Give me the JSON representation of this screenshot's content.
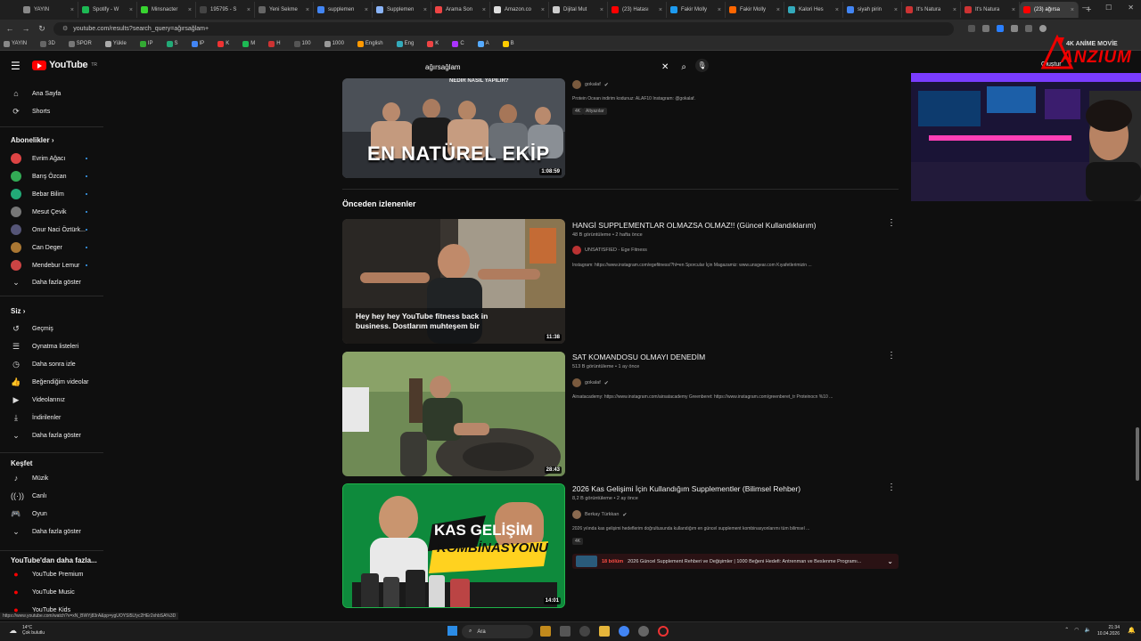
{
  "browser": {
    "tabs": [
      {
        "label": "YAYIN",
        "color": "#888"
      },
      {
        "label": "Spotify - W",
        "color": "#1db954"
      },
      {
        "label": "Minsnacter",
        "color": "#38d430"
      },
      {
        "label": "195795 - S",
        "color": "#444"
      },
      {
        "label": "Yeni Sekme",
        "color": "#666"
      },
      {
        "label": "supplemen",
        "color": "#4285f4"
      },
      {
        "label": "Supplemen",
        "color": "#8ab4f8"
      },
      {
        "label": "Arama Son",
        "color": "#e44"
      },
      {
        "label": "Amazon.co",
        "color": "#ddd"
      },
      {
        "label": "Dijital Mut",
        "color": "#ccc"
      },
      {
        "label": "(23) Hatası",
        "color": "#f00"
      },
      {
        "label": "Fakir Molly",
        "color": "#1d9bf0"
      },
      {
        "label": "Fakir Molly",
        "color": "#f60"
      },
      {
        "label": "Kalori Hes",
        "color": "#3ab"
      },
      {
        "label": "siyah pirin",
        "color": "#4285f4"
      },
      {
        "label": "It's Natura",
        "color": "#c33"
      },
      {
        "label": "It's Natura",
        "color": "#c33"
      },
      {
        "label": "(23) ağırsa",
        "color": "#f00"
      }
    ],
    "url": "youtube.com/results?search_query=ağırsağlam+",
    "bookmarks": [
      "YAYIN",
      "3D",
      "SPOR",
      "Yükle",
      "IP",
      "S",
      "IP",
      "K",
      "M",
      "H",
      "100",
      "1000",
      "English",
      "Eng",
      "K",
      "C",
      "A",
      "B"
    ]
  },
  "header": {
    "logo_text": "YouTube",
    "logo_sup": "TR",
    "search_query": "ağırsağlam",
    "create_label": "Oluştur"
  },
  "sidebar": {
    "home": "Ana Sayfa",
    "shorts": "Shorts",
    "subs_title": "Abonelikler",
    "channels": [
      {
        "name": "Evrim Ağacı",
        "color": "#d44"
      },
      {
        "name": "Barış Özcan",
        "color": "#3a5"
      },
      {
        "name": "Bebar Bilim",
        "color": "#2a7"
      },
      {
        "name": "Mesut Çevik",
        "color": "#777"
      },
      {
        "name": "Onur Naci Öztürk...",
        "color": "#557"
      },
      {
        "name": "Can Deger",
        "color": "#a73"
      },
      {
        "name": "Mendebur Lemur",
        "color": "#c44"
      }
    ],
    "subs_more": "Daha fazla göster",
    "you_title": "Siz",
    "you_items": [
      "Geçmiş",
      "Oynatma listeleri",
      "Daha sonra izle",
      "Beğendiğim videolar",
      "Videolarınız",
      "İndirilenler",
      "Daha fazla göster"
    ],
    "explore_title": "Keşfet",
    "explore_items": [
      "Müzik",
      "Canlı",
      "Oyun",
      "Daha fazla göster"
    ],
    "more_title": "YouTube'dan daha fazla...",
    "more_items": [
      "YouTube Premium",
      "YouTube Music",
      "YouTube Kids"
    ]
  },
  "results": {
    "first": {
      "thumb_text": "EN NATÜREL EKİP",
      "thumb_top": "NEDİR NASIL YAPILIR?",
      "duration": "1:08:59",
      "channel": "gokalaf",
      "desc": "Protein Ocean indirim kodunuz: ALAF10 Instagram: @gokalaf.",
      "badges": [
        "4K",
        "Altyazılar"
      ]
    },
    "section_title": "Önceden izlenenler",
    "videos": [
      {
        "title": "HANGİ SUPPLEMENTLAR OLMAZSA OLMAZ!! (Güncel Kullandıklarım)",
        "meta": "48 B görüntüleme • 2 hafta önce",
        "channel": "UNSATISFIED - Ege Fitness",
        "desc": "Instagram: https://www.instagram.com/egefitness/?hl=en Sporcular İçin Magazamiz: www.unsgear.com Kıyafetlerimizin ...",
        "duration": "11:38",
        "caption": "Hey hey hey YouTube fitness back in business. Dostlarım muhteşem bir"
      },
      {
        "title": "SAT KOMANDOSU OLMAYI DENEDİM",
        "meta": "513 B görüntüleme • 1 ay önce",
        "channel": "gokalaf",
        "desc": "Airsatacademy: https://www.instagram.com/airsatacademy Greenberet: https://www.instagram.com/greenberet_tr Proteinocn %10 ...",
        "duration": "28:43"
      },
      {
        "title": "2026 Kas Gelişimi İçin Kullandığım Supplementler (Bilimsel Rehber)",
        "meta": "8,2 B görüntüleme • 2 ay önce",
        "channel": "Berkay Türkkan",
        "desc": "2026 yılında kas gelişimi hedeflerim doğrultusunda kullandığım en güncel supplement kombinasyonlarımı tüm bilimsel ...",
        "duration": "14:01",
        "badge": "4K",
        "thumb_line1": "KAS GELİŞİM",
        "thumb_line2": "KOMBİNASYONU",
        "chapters_count": "18 bölüm",
        "chapters_text": "2026 Güncel Supplement Rehberi ve Değişimler | 1000 Beğeni Hedefi: Antrenman ve Beslenme Programı..."
      }
    ]
  },
  "overlay": {
    "brand_top": "4K ANİME MOVİE",
    "brand_main": "ANZIUM"
  },
  "statusbar": "https://www.youtube.com/watch?v=xN_BWYj83rA&pp=ygUOYSl5Lfyc2HEr2xhbSA%3D",
  "taskbar": {
    "weather_temp": "14°C",
    "weather_desc": "Çok bulutlu",
    "search": "Ara",
    "time": "21:34",
    "date": "10.04.2026"
  }
}
